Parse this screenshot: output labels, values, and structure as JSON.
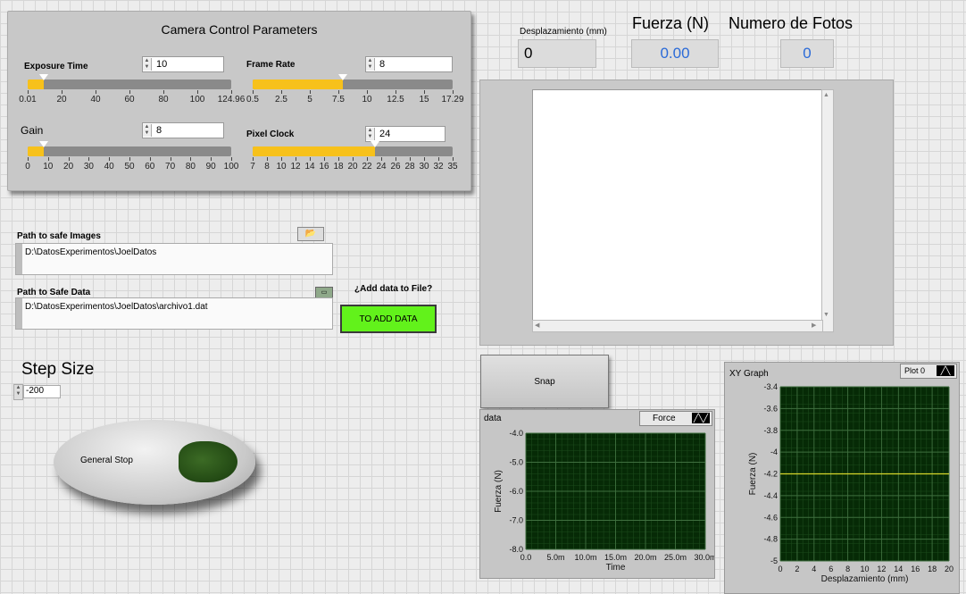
{
  "camera_panel": {
    "title": "Camera Control Parameters",
    "exposure": {
      "label": "Exposure Time",
      "value": "10",
      "level": 0.08,
      "ticks": [
        "0.01",
        "20",
        "40",
        "60",
        "80",
        "100",
        "124.96"
      ]
    },
    "frame_rate": {
      "label": "Frame Rate",
      "value": "8",
      "level": 0.45,
      "ticks": [
        "0.5",
        "2.5",
        "5",
        "7.5",
        "10",
        "12.5",
        "15",
        "17.29"
      ]
    },
    "gain": {
      "label": "Gain",
      "value": "8",
      "level": 0.08,
      "ticks": [
        "0",
        "10",
        "20",
        "30",
        "40",
        "50",
        "60",
        "70",
        "80",
        "90",
        "100"
      ]
    },
    "pixel_clock": {
      "label": "Pixel Clock",
      "value": "24",
      "level": 0.61,
      "ticks": [
        "7",
        "8",
        "10",
        "12",
        "14",
        "16",
        "18",
        "20",
        "22",
        "24",
        "26",
        "28",
        "30",
        "32",
        "35"
      ]
    },
    "colors": {
      "slider_fill": "#f7c11b",
      "slider_track": "#8a8a8a"
    }
  },
  "indicators": {
    "desplazamiento": {
      "label": "Desplazamiento (mm)",
      "value": "0"
    },
    "fuerza": {
      "label": "Fuerza (N)",
      "value": "0.00"
    },
    "fotos": {
      "label": "Numero de Fotos",
      "value": "0"
    }
  },
  "paths": {
    "images": {
      "label": "Path to safe Images",
      "value": "D:\\DatosExperimentos\\JoelDatos"
    },
    "data": {
      "label": "Path to Safe Data",
      "value": "D:\\DatosExperimentos\\JoelDatos\\archivo1.dat"
    }
  },
  "add_data": {
    "label": "¿Add data to File?",
    "button": "TO ADD DATA",
    "color": "#62f21b"
  },
  "step": {
    "label": "Step Size",
    "value": "-200"
  },
  "stop": {
    "label": "General Stop"
  },
  "snap": {
    "label": "Snap"
  },
  "chart_data": [
    {
      "type": "line",
      "title": "data",
      "legend": "Force",
      "xlabel": "Time",
      "ylabel": "Fuerza (N)",
      "xticks": [
        "0.0",
        "5.0m",
        "10.0m",
        "15.0m",
        "20.0m",
        "25.0m",
        "30.0m"
      ],
      "yticks": [
        "-4.0",
        "-5.0",
        "-6.0",
        "-7.0",
        "-8.0"
      ],
      "xlim": [
        0,
        0.03
      ],
      "ylim": [
        -8.0,
        -4.0
      ],
      "grid": true,
      "series": [
        {
          "name": "Force",
          "x": [],
          "y": []
        }
      ]
    },
    {
      "type": "line",
      "title": "XY Graph",
      "legend": "Plot 0",
      "xlabel": "Desplazamiento (mm)",
      "ylabel": "Fuerza (N)",
      "xticks": [
        "0",
        "2",
        "4",
        "6",
        "8",
        "10",
        "12",
        "14",
        "16",
        "18",
        "20"
      ],
      "yticks": [
        "-3.4",
        "-3.6",
        "-3.8",
        "-4",
        "-4.2",
        "-4.4",
        "-4.6",
        "-4.8",
        "-5"
      ],
      "xlim": [
        0,
        20
      ],
      "ylim": [
        -5,
        -3.4
      ],
      "grid": true,
      "series": [
        {
          "name": "Plot 0",
          "x": [
            0,
            20
          ],
          "y": [
            -4.2,
            -4.2
          ]
        }
      ]
    }
  ]
}
